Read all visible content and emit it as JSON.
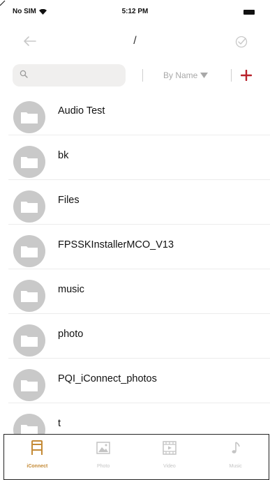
{
  "status_bar": {
    "carrier": "No SIM",
    "time": "5:12 PM"
  },
  "nav": {
    "title": "/"
  },
  "toolbar": {
    "search_placeholder": "",
    "sort_label": "By Name"
  },
  "files": [
    {
      "name": "Audio Test"
    },
    {
      "name": "bk"
    },
    {
      "name": "Files"
    },
    {
      "name": "FPSSKInstallerMCO_V13"
    },
    {
      "name": "music"
    },
    {
      "name": "photo"
    },
    {
      "name": "PQI_iConnect_photos"
    },
    {
      "name": "t"
    }
  ],
  "tabs": [
    {
      "label": "iConnect",
      "icon": "iconnect-icon",
      "active": true
    },
    {
      "label": "Photo",
      "icon": "photo-icon",
      "active": false
    },
    {
      "label": "Video",
      "icon": "video-icon",
      "active": false
    },
    {
      "label": "Music",
      "icon": "music-icon",
      "active": false
    }
  ],
  "colors": {
    "accent": "#c48a36",
    "icon_gray": "#c9c9c9",
    "inactive": "#c4c4c4"
  }
}
